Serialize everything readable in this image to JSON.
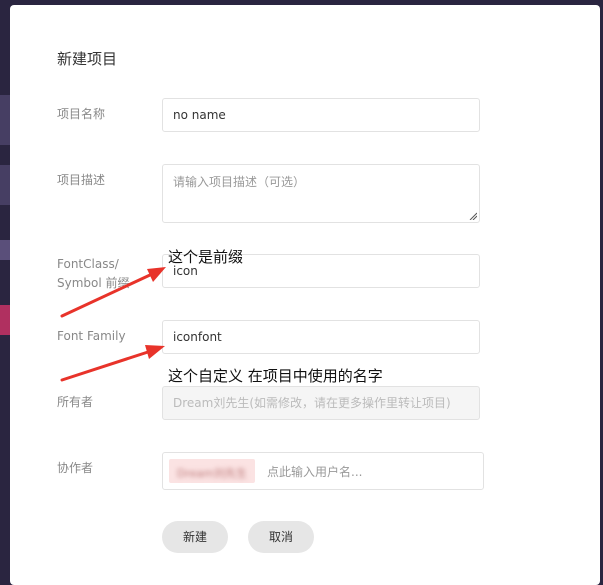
{
  "modal": {
    "title": "新建项目",
    "buttons": {
      "create": "新建",
      "cancel": "取消"
    }
  },
  "form": {
    "name": {
      "label": "项目名称",
      "value": "no name"
    },
    "description": {
      "label": "项目描述",
      "placeholder": "请输入项目描述（可选）"
    },
    "prefix": {
      "label_line1": "FontClass/",
      "label_line2": "Symbol 前缀",
      "value": "icon"
    },
    "family": {
      "label": "Font Family",
      "value": "iconfont"
    },
    "owner": {
      "label": "所有者",
      "value": "Dream刘先生(如需修改，请在更多操作里转让项目)"
    },
    "collaborators": {
      "label": "协作者",
      "member": "Dream刘先生",
      "placeholder": "点此输入用户名..."
    }
  },
  "annotations": {
    "prefix_note": "这个是前缀",
    "family_note": "这个自定义  在项目中使用的名字"
  },
  "colors": {
    "arrow": "#e8332a",
    "backdrop": "#2a2540",
    "chip": "#fbe3e3"
  },
  "icons": [
    "red-arrow-icon",
    "resize-grip-icon"
  ]
}
